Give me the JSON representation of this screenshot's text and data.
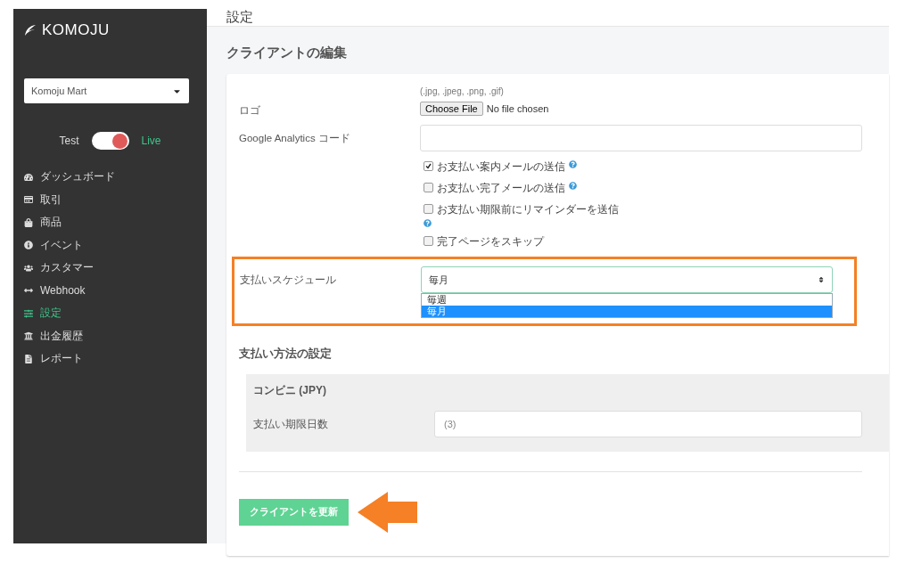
{
  "sidebar": {
    "logo": "KOMOJU",
    "store_select": {
      "value": "Komoju Mart"
    },
    "mode_toggle": {
      "left_label": "Test",
      "right_label": "Live",
      "on": true
    },
    "items": [
      {
        "kind": "dashboard",
        "label": "ダッシュボード",
        "selected": false
      },
      {
        "kind": "card",
        "label": "取引",
        "selected": false
      },
      {
        "kind": "bag",
        "label": "商品",
        "selected": false
      },
      {
        "kind": "info",
        "label": "イベント",
        "selected": false
      },
      {
        "kind": "users",
        "label": "カスタマー",
        "selected": false
      },
      {
        "kind": "arrows",
        "label": "Webhook",
        "selected": false
      },
      {
        "kind": "sliders",
        "label": "設定",
        "selected": true
      },
      {
        "kind": "bank",
        "label": "出金履歴",
        "selected": false
      },
      {
        "kind": "file",
        "label": "レポート",
        "selected": false
      }
    ]
  },
  "header": {
    "title": "設定"
  },
  "edit": {
    "title": "クライアントの編集",
    "logo": {
      "label": "ロゴ",
      "hint": "(.jpg, .jpeg, .png, .gif)",
      "button": "Choose File",
      "status": "No file chosen"
    },
    "analytics": {
      "label": "Google Analytics コード"
    },
    "checkboxes": [
      {
        "label": "お支払い案内メールの送信",
        "checked": true,
        "kind": "help"
      },
      {
        "label": "お支払い完了メールの送信",
        "checked": false,
        "kind": "help"
      },
      {
        "label": "お支払い期限前にリマインダーを送信",
        "checked": false,
        "kind": "wrapped"
      },
      {
        "label": "完了ページをスキップ",
        "checked": false,
        "kind": "plain"
      }
    ],
    "schedule": {
      "label": "支払いスケジュール",
      "value": "毎月",
      "options": [
        {
          "label": "毎週",
          "selected": false
        },
        {
          "label": "毎月",
          "selected": true
        }
      ]
    },
    "payment": {
      "title": "支払い方法の設定",
      "methods": [
        {
          "title": "コンビニ (JPY)",
          "field_label": "支払い期限日数",
          "placeholder": "(3)"
        }
      ]
    },
    "submit": "クライアントを更新"
  }
}
